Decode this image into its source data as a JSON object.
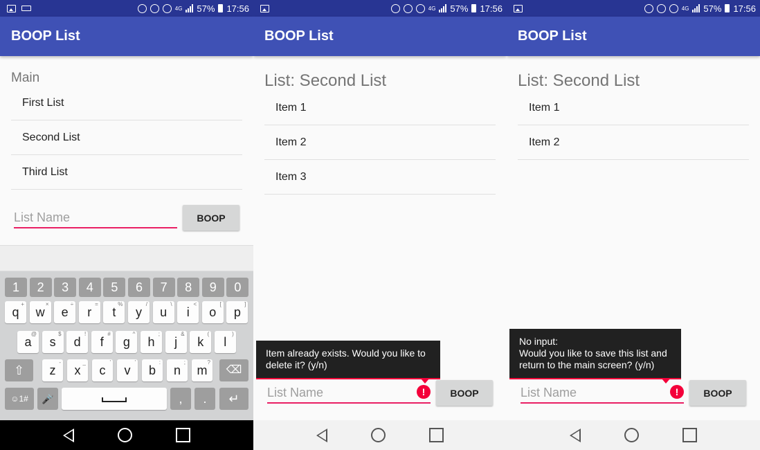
{
  "status": {
    "battery": "57%",
    "time": "17:56",
    "network": "4G"
  },
  "app_title": "BOOP List",
  "panel1": {
    "heading": "Main",
    "items": [
      "First List",
      "Second List",
      "Third List"
    ],
    "input_placeholder": "List Name",
    "button": "BOOP",
    "keyboard": {
      "numbers": [
        "1",
        "2",
        "3",
        "4",
        "5",
        "6",
        "7",
        "8",
        "9",
        "0"
      ],
      "row1": [
        {
          "k": "q",
          "s": "+"
        },
        {
          "k": "w",
          "s": "×"
        },
        {
          "k": "e",
          "s": "÷"
        },
        {
          "k": "r",
          "s": "="
        },
        {
          "k": "t",
          "s": "%"
        },
        {
          "k": "y",
          "s": "/"
        },
        {
          "k": "u",
          "s": "\\"
        },
        {
          "k": "i",
          "s": "<"
        },
        {
          "k": "o",
          "s": "["
        },
        {
          "k": "p",
          "s": "]"
        }
      ],
      "row2": [
        {
          "k": "a",
          "s": "@"
        },
        {
          "k": "s",
          "s": "$"
        },
        {
          "k": "d",
          "s": "!"
        },
        {
          "k": "f",
          "s": "#"
        },
        {
          "k": "g",
          "s": "^"
        },
        {
          "k": "h",
          "s": ";"
        },
        {
          "k": "j",
          "s": "&"
        },
        {
          "k": "k",
          "s": "("
        },
        {
          "k": "l",
          "s": ")"
        }
      ],
      "row3": [
        {
          "k": "z",
          "s": "-"
        },
        {
          "k": "x",
          "s": "_"
        },
        {
          "k": "c",
          "s": "'"
        },
        {
          "k": "v",
          "s": "'"
        },
        {
          "k": "b",
          "s": ":"
        },
        {
          "k": "n",
          "s": ";"
        },
        {
          "k": "m",
          "s": "?"
        }
      ],
      "symbols_key": "☺1#",
      "comma": ",",
      "period": "."
    }
  },
  "panel2": {
    "heading": "List: Second List",
    "items": [
      "Item 1",
      "Item 2",
      "Item 3"
    ],
    "tooltip": "Item already exists. Would you like to delete it? (y/n)",
    "input_placeholder": "List Name",
    "button": "BOOP"
  },
  "panel3": {
    "heading": "List: Second List",
    "items": [
      "Item 1",
      "Item 2"
    ],
    "tooltip_line1": "No input:",
    "tooltip_line2": "Would you like to save this list and return to the main screen?  (y/n)",
    "input_placeholder": "List Name",
    "button": "BOOP"
  },
  "colors": {
    "status_bar": "#283593",
    "app_bar": "#3f51b5",
    "accent": "#e91e63",
    "error": "#f4003a"
  }
}
